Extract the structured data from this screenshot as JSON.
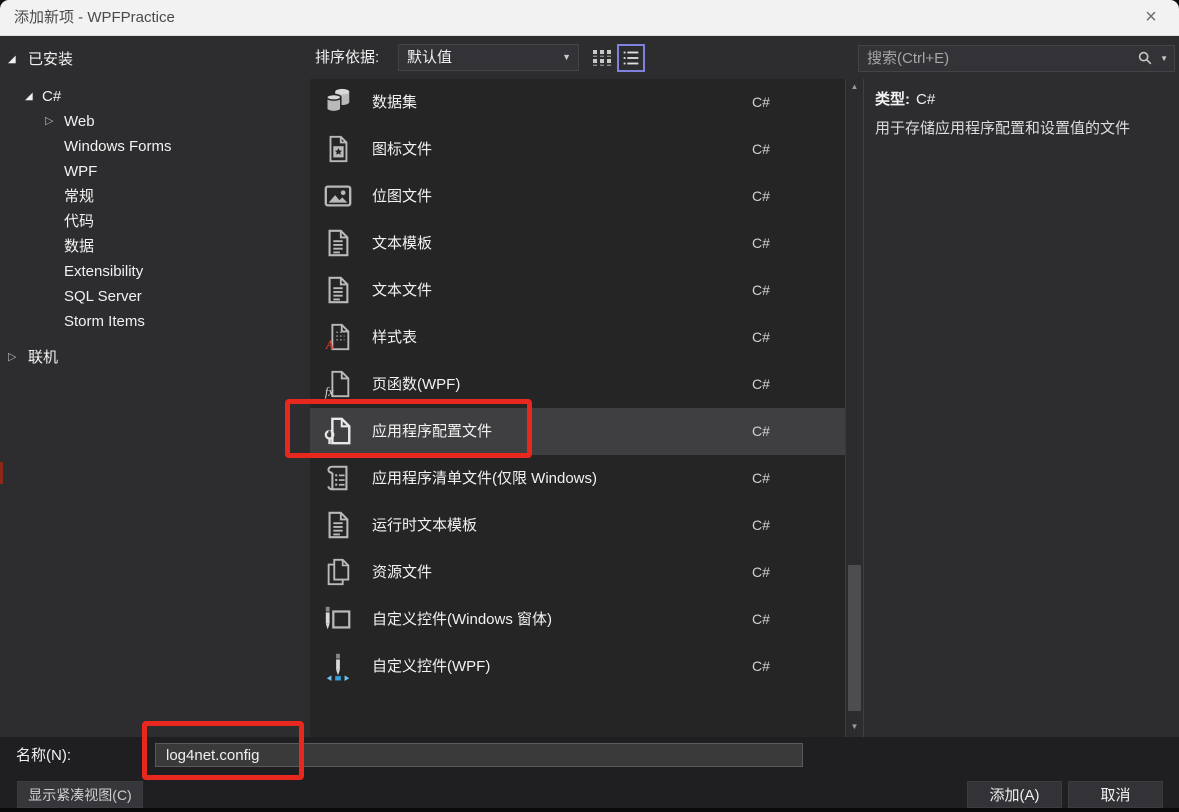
{
  "window": {
    "title": "添加新项 - WPFPractice"
  },
  "sidebar": {
    "installed": {
      "label": "已安装"
    },
    "tree": [
      {
        "label": "C#",
        "level": 1,
        "state": "expanded"
      },
      {
        "label": "Web",
        "level": 2,
        "state": "collapsed"
      },
      {
        "label": "Windows Forms",
        "level": 2,
        "state": "none"
      },
      {
        "label": "WPF",
        "level": 2,
        "state": "none"
      },
      {
        "label": "常规",
        "level": 2,
        "state": "none"
      },
      {
        "label": "代码",
        "level": 2,
        "state": "none"
      },
      {
        "label": "数据",
        "level": 2,
        "state": "none"
      },
      {
        "label": "Extensibility",
        "level": 2,
        "state": "none"
      },
      {
        "label": "SQL Server",
        "level": 2,
        "state": "none"
      },
      {
        "label": "Storm Items",
        "level": 2,
        "state": "none"
      }
    ],
    "online": {
      "label": "联机"
    }
  },
  "toolbar": {
    "sort_label": "排序依据:",
    "sort_value": "默认值"
  },
  "search": {
    "placeholder": "搜索(Ctrl+E)"
  },
  "templates": [
    {
      "name": "数据集",
      "lang": "C#",
      "icon": "dataset"
    },
    {
      "name": "图标文件",
      "lang": "C#",
      "icon": "icon-file"
    },
    {
      "name": "位图文件",
      "lang": "C#",
      "icon": "bitmap-file"
    },
    {
      "name": "文本模板",
      "lang": "C#",
      "icon": "text-template"
    },
    {
      "name": "文本文件",
      "lang": "C#",
      "icon": "text-file"
    },
    {
      "name": "样式表",
      "lang": "C#",
      "icon": "stylesheet"
    },
    {
      "name": "页函数(WPF)",
      "lang": "C#",
      "icon": "page-function"
    },
    {
      "name": "应用程序配置文件",
      "lang": "C#",
      "icon": "app-config",
      "selected": true
    },
    {
      "name": "应用程序清单文件(仅限 Windows)",
      "lang": "C#",
      "icon": "app-manifest"
    },
    {
      "name": "运行时文本模板",
      "lang": "C#",
      "icon": "runtime-text-template"
    },
    {
      "name": "资源文件",
      "lang": "C#",
      "icon": "resource-file"
    },
    {
      "name": "自定义控件(Windows 窗体)",
      "lang": "C#",
      "icon": "custom-control-winforms"
    },
    {
      "name": "自定义控件(WPF)",
      "lang": "C#",
      "icon": "custom-control-wpf"
    }
  ],
  "details": {
    "type_label": "类型:",
    "type_value": "C#",
    "description": "用于存储应用程序配置和设置值的文件"
  },
  "footer": {
    "name_label": "名称(N):",
    "name_value": "log4net.config",
    "compact_view_button": "显示紧凑视图(C)",
    "add_button": "添加(A)",
    "cancel_button": "取消"
  },
  "colors": {
    "annotation_red": "#e8281f",
    "accent_purple": "#8080dd",
    "selection_bg": "#3f3f41",
    "titlebar_bg": "#f2f2f2",
    "panel_bg": "#2d2d30",
    "list_bg": "#252526"
  }
}
